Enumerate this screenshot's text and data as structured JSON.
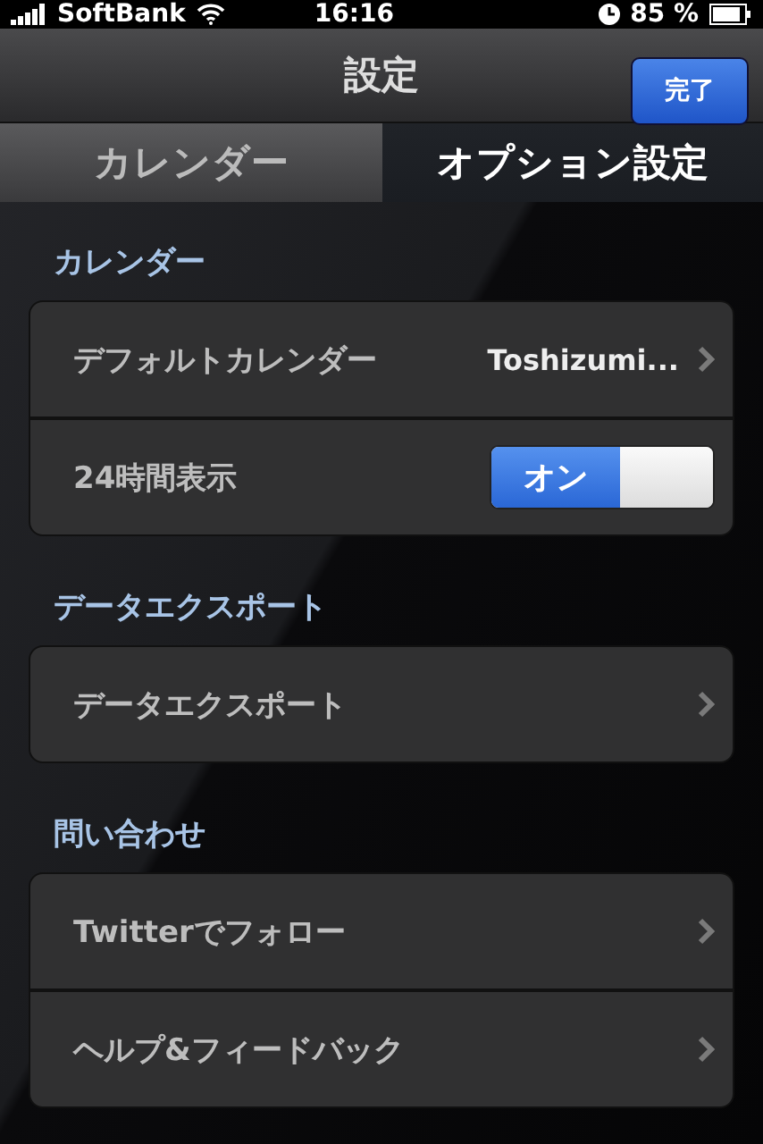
{
  "status_bar": {
    "carrier": "SoftBank",
    "time": "16:16",
    "battery": "85 %"
  },
  "nav": {
    "title": "設定",
    "done_button": "完了"
  },
  "tabs": [
    {
      "label": "カレンダー",
      "selected": false
    },
    {
      "label": "オプション設定",
      "selected": true
    }
  ],
  "sections": [
    {
      "header": "カレンダー",
      "rows": [
        {
          "kind": "link",
          "label": "デフォルトカレンダー",
          "value": "Toshizumi..."
        },
        {
          "kind": "toggle",
          "label": "24時間表示",
          "on": true,
          "on_label": "オン"
        }
      ]
    },
    {
      "header": "データエクスポート",
      "rows": [
        {
          "kind": "link",
          "label": "データエクスポート"
        }
      ]
    },
    {
      "header": "問い合わせ",
      "rows": [
        {
          "kind": "link",
          "label": "Twitterでフォロー"
        },
        {
          "kind": "link",
          "label": "ヘルプ&フィードバック"
        }
      ]
    }
  ]
}
